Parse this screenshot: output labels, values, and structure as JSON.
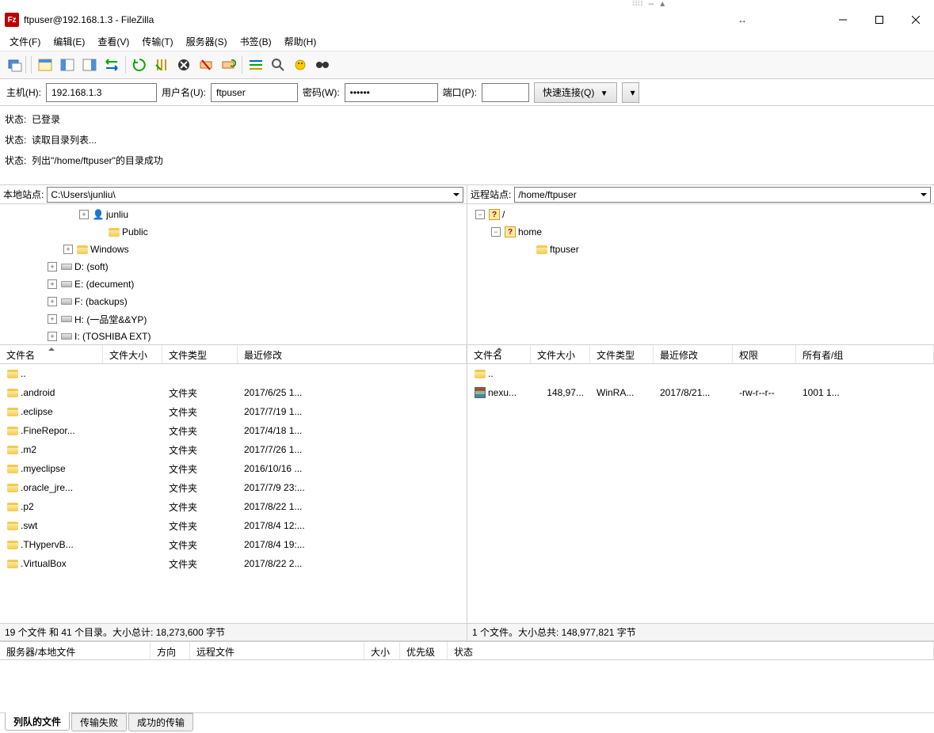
{
  "window": {
    "title": "ftpuser@192.168.1.3 - FileZilla"
  },
  "menu": {
    "file": "文件(F)",
    "edit": "编辑(E)",
    "view": "查看(V)",
    "transfer": "传输(T)",
    "server": "服务器(S)",
    "bookmarks": "书签(B)",
    "help": "帮助(H)"
  },
  "quickconnect": {
    "host_label": "主机(H):",
    "host_value": "192.168.1.3",
    "user_label": "用户名(U):",
    "user_value": "ftpuser",
    "pass_label": "密码(W):",
    "pass_value": "••••••",
    "port_label": "端口(P):",
    "port_value": "",
    "connect_label": "快速连接(Q)"
  },
  "log": [
    {
      "label": "状态:",
      "msg": "已登录"
    },
    {
      "label": "状态:",
      "msg": "读取目录列表..."
    },
    {
      "label": "状态:",
      "msg": "列出\"/home/ftpuser\"的目录成功"
    }
  ],
  "local": {
    "path_label": "本地站点:",
    "path": "C:\\Users\\junliu\\",
    "tree": [
      {
        "indent": 100,
        "exp": "+",
        "icon": "user",
        "label": "junliu"
      },
      {
        "indent": 120,
        "exp": " ",
        "icon": "folder",
        "label": "Public"
      },
      {
        "indent": 80,
        "exp": "+",
        "icon": "folder",
        "label": "Windows"
      },
      {
        "indent": 60,
        "exp": "+",
        "icon": "drive",
        "label": "D: (soft)"
      },
      {
        "indent": 60,
        "exp": "+",
        "icon": "drive",
        "label": "E: (decument)"
      },
      {
        "indent": 60,
        "exp": "+",
        "icon": "drive",
        "label": "F: (backups)"
      },
      {
        "indent": 60,
        "exp": "+",
        "icon": "drive",
        "label": "H: (一品堂&&YP)"
      },
      {
        "indent": 60,
        "exp": "+",
        "icon": "drive",
        "label": "I: (TOSHIBA EXT)"
      }
    ],
    "columns": {
      "name": "文件名",
      "size": "文件大小",
      "type": "文件类型",
      "modified": "最近修改"
    },
    "colwidths": {
      "name": 130,
      "size": 75,
      "type": 95,
      "modified": 270
    },
    "files": [
      {
        "name": "..",
        "size": "",
        "type": "",
        "modified": ""
      },
      {
        "name": ".android",
        "size": "",
        "type": "文件夹",
        "modified": "2017/6/25 1..."
      },
      {
        "name": ".eclipse",
        "size": "",
        "type": "文件夹",
        "modified": "2017/7/19 1..."
      },
      {
        "name": ".FineRepor...",
        "size": "",
        "type": "文件夹",
        "modified": "2017/4/18 1..."
      },
      {
        "name": ".m2",
        "size": "",
        "type": "文件夹",
        "modified": "2017/7/26 1..."
      },
      {
        "name": ".myeclipse",
        "size": "",
        "type": "文件夹",
        "modified": "2016/10/16 ..."
      },
      {
        "name": ".oracle_jre...",
        "size": "",
        "type": "文件夹",
        "modified": "2017/7/9 23:..."
      },
      {
        "name": ".p2",
        "size": "",
        "type": "文件夹",
        "modified": "2017/8/22 1..."
      },
      {
        "name": ".swt",
        "size": "",
        "type": "文件夹",
        "modified": "2017/8/4 12:..."
      },
      {
        "name": ".THypervB...",
        "size": "",
        "type": "文件夹",
        "modified": "2017/8/4 19:..."
      },
      {
        "name": ".VirtualBox",
        "size": "",
        "type": "文件夹",
        "modified": "2017/8/22 2..."
      }
    ],
    "status": "19 个文件 和 41 个目录。大小总计: 18,273,600 字节"
  },
  "remote": {
    "path_label": "远程站点:",
    "path": "/home/ftpuser",
    "tree": [
      {
        "indent": 10,
        "exp": "-",
        "icon": "q",
        "label": "/"
      },
      {
        "indent": 30,
        "exp": "-",
        "icon": "q",
        "label": "home"
      },
      {
        "indent": 70,
        "exp": " ",
        "icon": "folder",
        "label": "ftpuser"
      }
    ],
    "columns": {
      "name": "文件名",
      "size": "文件大小",
      "type": "文件类型",
      "modified": "最近修改",
      "perm": "权限",
      "owner": "所有者/组"
    },
    "colwidths": {
      "name": 80,
      "size": 75,
      "type": 80,
      "modified": 100,
      "perm": 80,
      "owner": 110
    },
    "files": [
      {
        "name": "..",
        "size": "",
        "type": "",
        "modified": "",
        "perm": "",
        "owner": ""
      },
      {
        "name": "nexu...",
        "size": "148,97...",
        "type": "WinRA...",
        "modified": "2017/8/21...",
        "perm": "-rw-r--r--",
        "owner": "1001 1..."
      }
    ],
    "status": "1 个文件。大小总共: 148,977,821 字节"
  },
  "queue": {
    "columns": {
      "server": "服务器/本地文件",
      "dir": "方向",
      "remote": "远程文件",
      "size": "大小",
      "prio": "优先级",
      "status": "状态"
    },
    "colwidths": {
      "server": 190,
      "dir": 50,
      "remote": 220,
      "size": 45,
      "prio": 60,
      "status": 200
    },
    "tabs": {
      "queued": "列队的文件",
      "failed": "传输失败",
      "ok": "成功的传输"
    }
  }
}
